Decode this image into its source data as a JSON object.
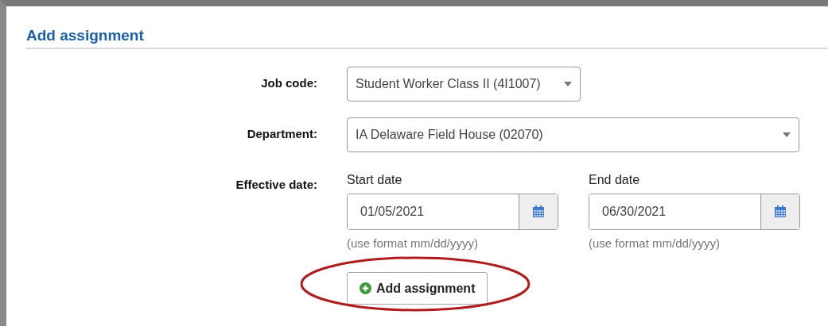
{
  "title": "Add assignment",
  "job_code": {
    "label": "Job code:",
    "value": "Student Worker Class II (4I1007)"
  },
  "department": {
    "label": "Department:",
    "value": "IA Delaware Field House (02070)"
  },
  "effective_date": {
    "label": "Effective date:",
    "fields": [
      {
        "label": "Start date",
        "value": "01/05/2021",
        "hint": "(use format mm/dd/yyyy)"
      },
      {
        "label": "End date",
        "value": "06/30/2021",
        "hint": "(use format mm/dd/yyyy)"
      }
    ]
  },
  "button": {
    "label": "Add assignment",
    "highlighted": true
  }
}
